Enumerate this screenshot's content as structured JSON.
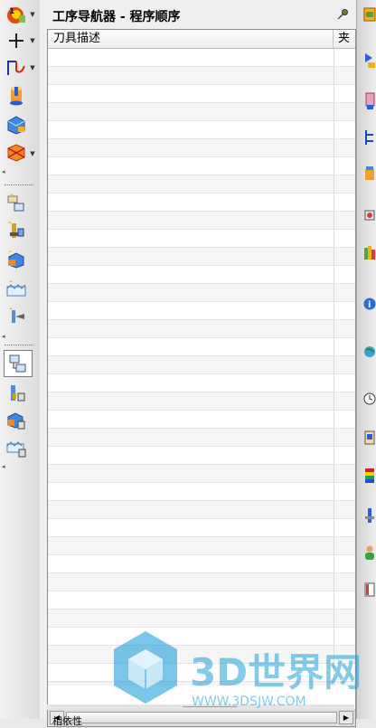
{
  "navigator": {
    "title": "工序导航器 - 程序顺序",
    "columns": [
      "刀具描述",
      "夹"
    ]
  },
  "watermark": {
    "brand": "3D世界网",
    "url": "WWW.3DSJW.COM"
  },
  "footer": {
    "label": "相依性"
  },
  "colors": {
    "accent": "#1fa0d9",
    "panel_bg": "#efefef"
  }
}
